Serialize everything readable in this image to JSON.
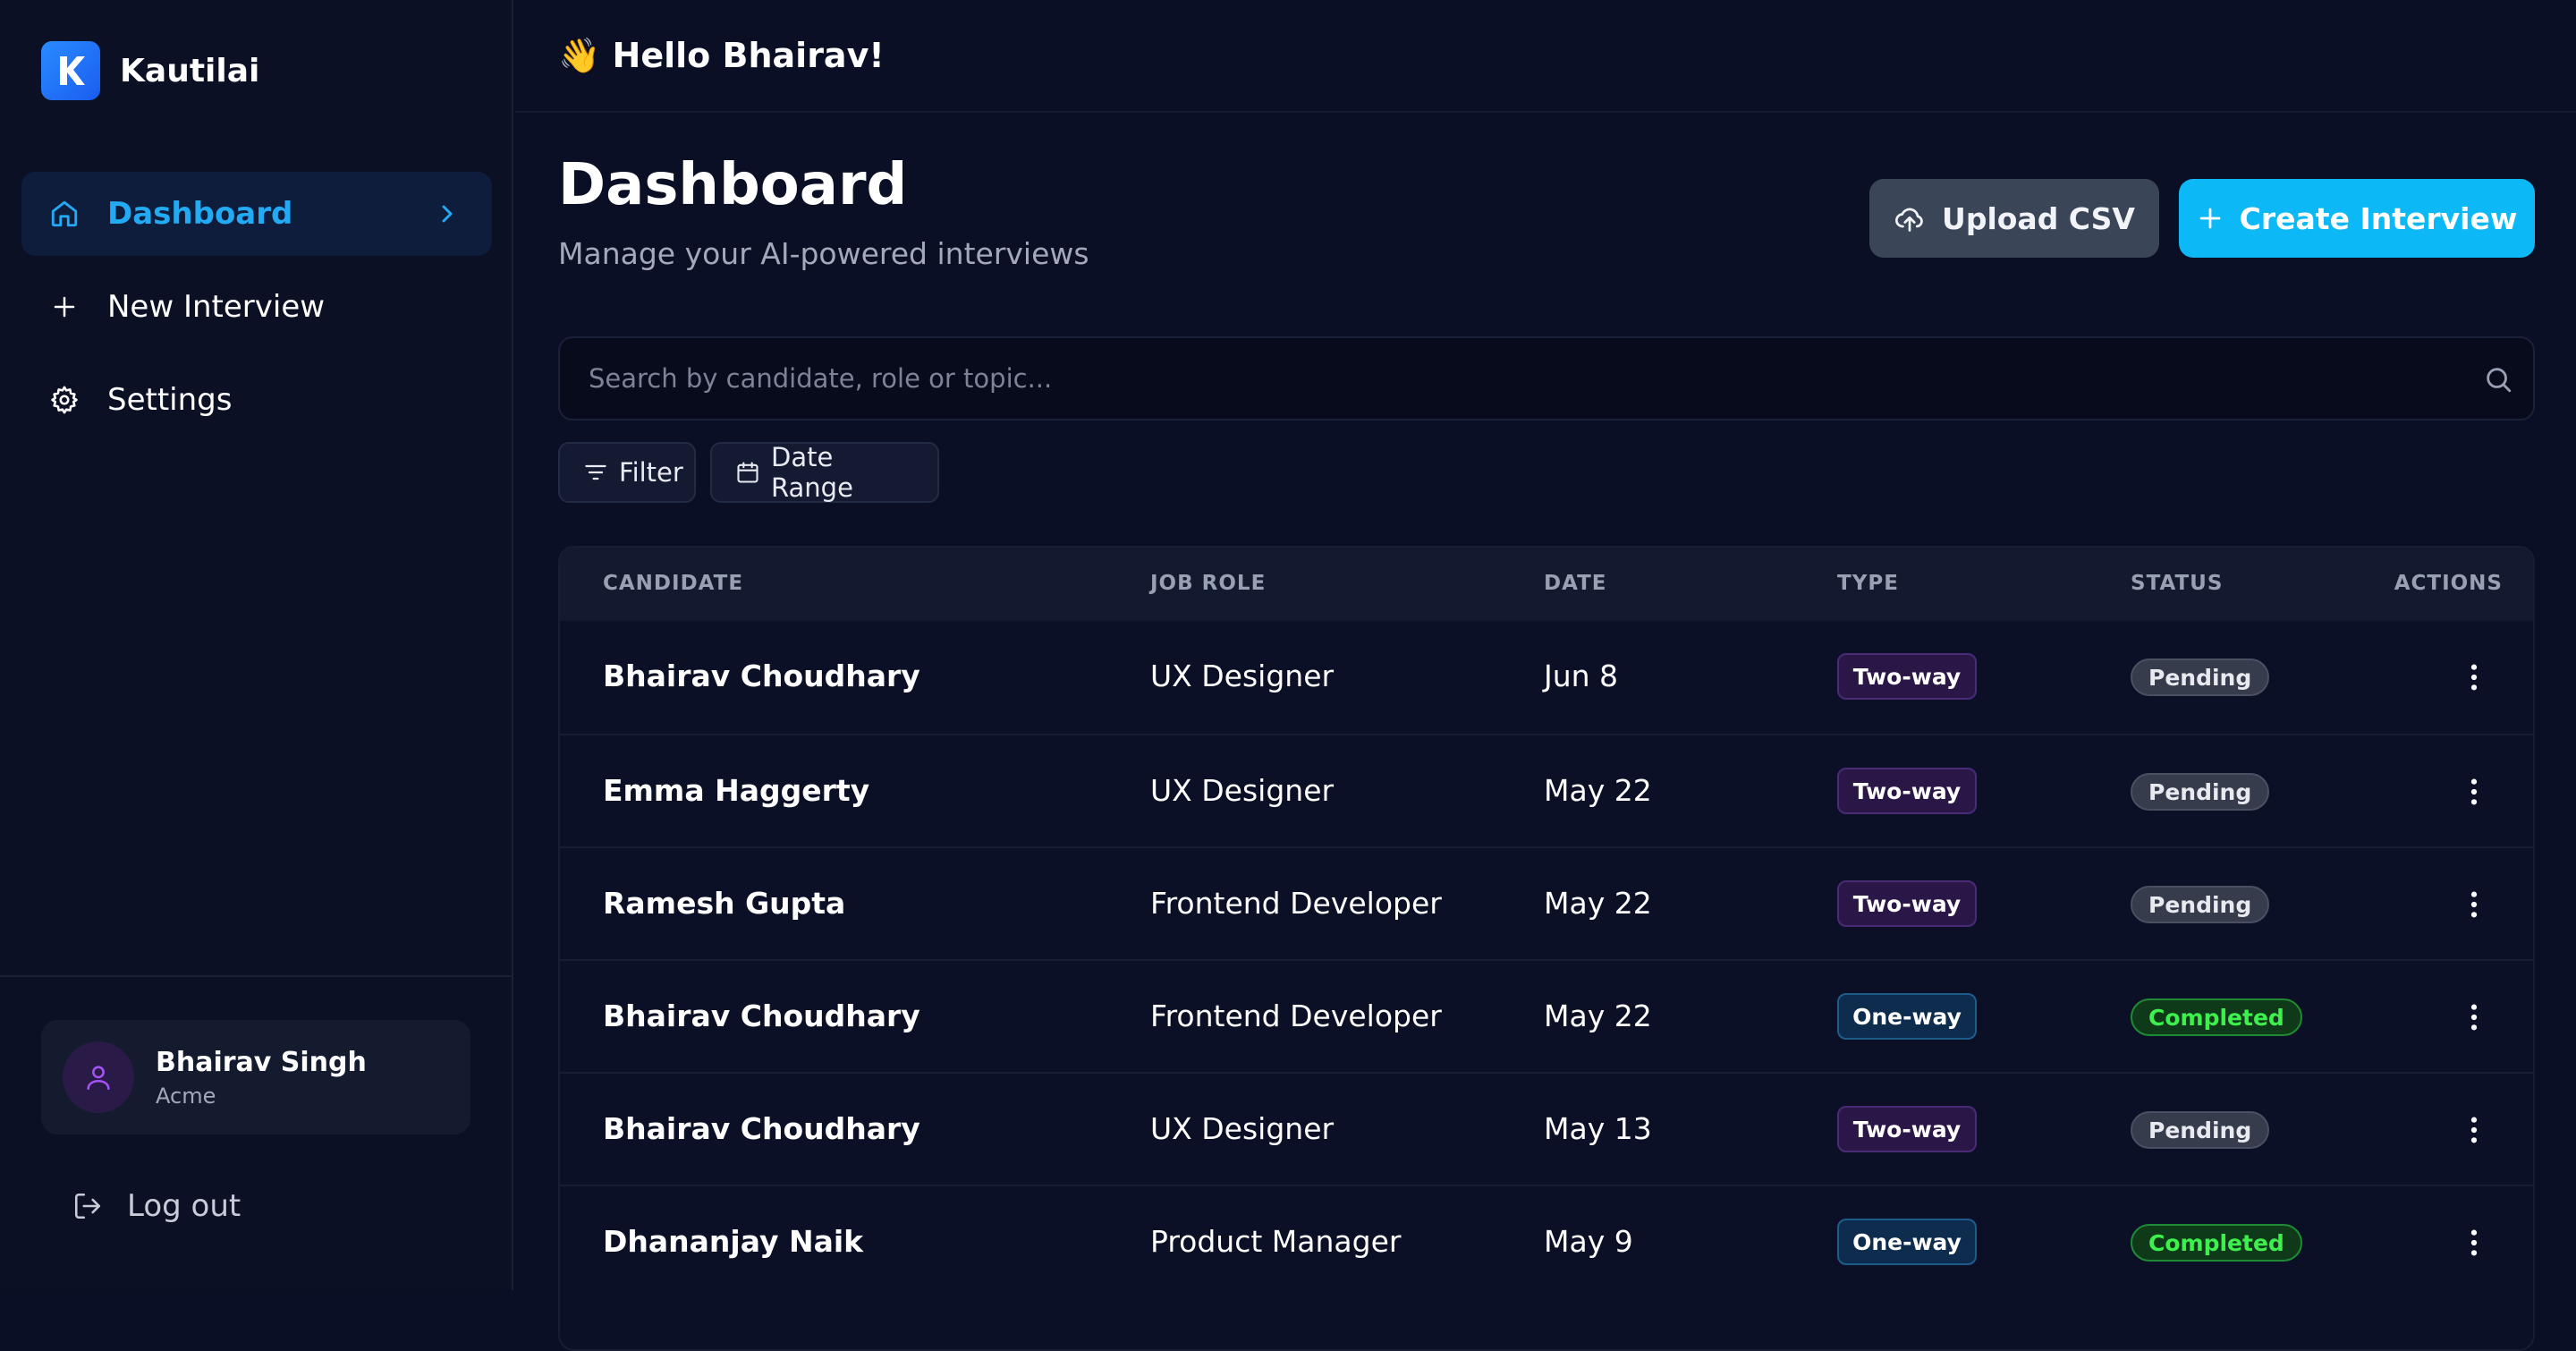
{
  "app": {
    "name": "Kautilai"
  },
  "sidebar": {
    "items": [
      {
        "label": "Dashboard",
        "icon": "home-icon",
        "active": true
      },
      {
        "label": "New Interview",
        "icon": "plus-icon",
        "active": false
      },
      {
        "label": "Settings",
        "icon": "gear-icon",
        "active": false
      }
    ],
    "user": {
      "name": "Bhairav Singh",
      "org": "Acme"
    },
    "logout_label": "Log out"
  },
  "header": {
    "greeting": "👋 Hello Bhairav!"
  },
  "page": {
    "title": "Dashboard",
    "subtitle": "Manage your AI-powered interviews",
    "upload_label": "Upload CSV",
    "create_label": "Create Interview"
  },
  "search": {
    "placeholder": "Search by candidate, role or topic...",
    "value": ""
  },
  "filters": {
    "filter_label": "Filter",
    "date_label": "Date Range"
  },
  "table": {
    "headers": [
      "CANDIDATE",
      "JOB ROLE",
      "DATE",
      "TYPE",
      "STATUS",
      "ACTIONS"
    ],
    "rows": [
      {
        "candidate": "Bhairav Choudhary",
        "role": "UX Designer",
        "date": "Jun 8",
        "type": "Two-way",
        "status": "Pending"
      },
      {
        "candidate": "Emma Haggerty",
        "role": "UX Designer",
        "date": "May 22",
        "type": "Two-way",
        "status": "Pending"
      },
      {
        "candidate": "Ramesh Gupta",
        "role": "Frontend Developer",
        "date": "May 22",
        "type": "Two-way",
        "status": "Pending"
      },
      {
        "candidate": "Bhairav Choudhary",
        "role": "Frontend Developer",
        "date": "May 22",
        "type": "One-way",
        "status": "Completed"
      },
      {
        "candidate": "Bhairav Choudhary",
        "role": "UX Designer",
        "date": "May 13",
        "type": "Two-way",
        "status": "Pending"
      },
      {
        "candidate": "Dhananjay Naik",
        "role": "Product Manager",
        "date": "May 9",
        "type": "One-way",
        "status": "Completed"
      }
    ]
  },
  "colors": {
    "accent": "#0cb8f5",
    "active_nav": "#22aaf5",
    "background": "#0a0f26"
  }
}
